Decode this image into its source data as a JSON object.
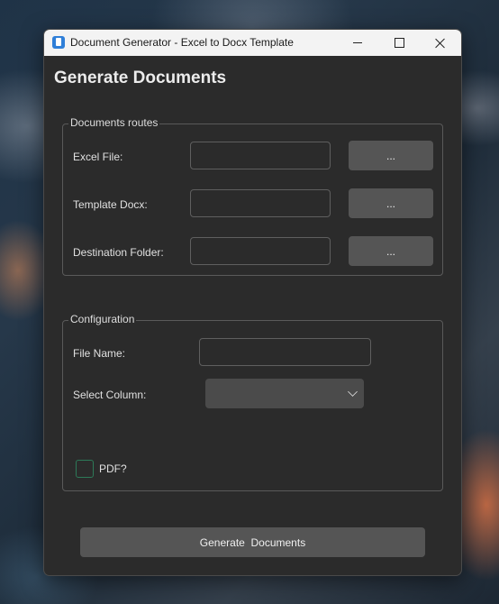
{
  "window": {
    "title": "Document Generator - Excel to Docx Template"
  },
  "page": {
    "heading": "Generate Documents"
  },
  "routes": {
    "group_title": "Documents routes",
    "excel_label": "Excel File:",
    "excel_value": "",
    "template_label": "Template Docx:",
    "template_value": "",
    "destination_label": "Destination Folder:",
    "destination_value": "",
    "browse_label": "..."
  },
  "configuration": {
    "group_title": "Configuration",
    "file_name_label": "File Name:",
    "file_name_value": "",
    "select_column_label": "Select Column:",
    "select_column_value": "",
    "pdf_label": "PDF?",
    "pdf_checked": false
  },
  "actions": {
    "generate_label": "Generate  Documents"
  },
  "icons": {
    "app": "document-app-icon",
    "minimize": "minimize-icon",
    "maximize": "maximize-icon",
    "close": "close-icon",
    "dropdown": "chevron-down-icon"
  },
  "colors": {
    "window_bg": "#2b2b2b",
    "button_bg": "#555555",
    "checkbox_border": "#2d7a58"
  }
}
